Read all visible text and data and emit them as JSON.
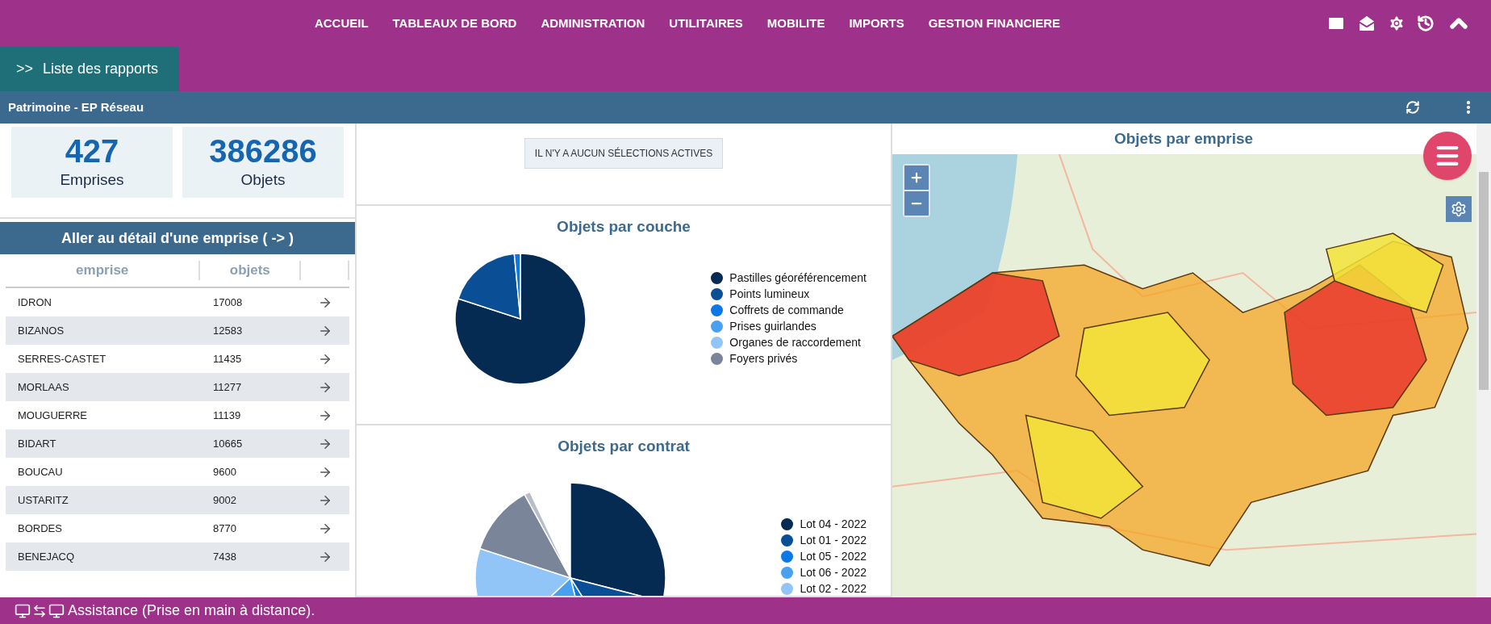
{
  "nav": {
    "items": [
      "ACCUEIL",
      "TABLEAUX DE BORD",
      "ADMINISTRATION",
      "UTILITAIRES",
      "MOBILITE",
      "IMPORTS",
      "GESTION FINANCIERE"
    ]
  },
  "reports_button": {
    "prefix": ">>",
    "label": "Liste des rapports"
  },
  "page_title": "Patrimoine - EP Réseau",
  "stats": [
    {
      "value": "427",
      "label": "Emprises"
    },
    {
      "value": "386286",
      "label": "Objets"
    }
  ],
  "detail_table": {
    "title": "Aller au détail d'une emprise ( -> )",
    "columns": [
      "emprise",
      "objets"
    ],
    "rows": [
      {
        "emprise": "IDRON",
        "objets": "17008"
      },
      {
        "emprise": "BIZANOS",
        "objets": "12583"
      },
      {
        "emprise": "SERRES-CASTET",
        "objets": "11435"
      },
      {
        "emprise": "MORLAAS",
        "objets": "11277"
      },
      {
        "emprise": "MOUGUERRE",
        "objets": "11139"
      },
      {
        "emprise": "BIDART",
        "objets": "10665"
      },
      {
        "emprise": "BOUCAU",
        "objets": "9600"
      },
      {
        "emprise": "USTARITZ",
        "objets": "9002"
      },
      {
        "emprise": "BORDES",
        "objets": "8770"
      },
      {
        "emprise": "BENEJACQ",
        "objets": "7438"
      }
    ]
  },
  "selection_notice": "IL N'Y A AUCUN SÉLECTIONS ACTIVES",
  "charts": [
    {
      "title": "Objets par couche",
      "legend": [
        {
          "label": "Pastilles géoréférencement",
          "color": "#052b52"
        },
        {
          "label": "Points lumineux",
          "color": "#0a4f96"
        },
        {
          "label": "Coffrets de commande",
          "color": "#0a78e6"
        },
        {
          "label": "Prises guirlandes",
          "color": "#4aa0f0"
        },
        {
          "label": "Organes de raccordement",
          "color": "#92c5f7"
        },
        {
          "label": "Foyers privés",
          "color": "#7a8599"
        }
      ]
    },
    {
      "title": "Objets par contrat",
      "legend": [
        {
          "label": "Lot 04 - 2022",
          "color": "#052b52"
        },
        {
          "label": "Lot 01 - 2022",
          "color": "#0a4f96"
        },
        {
          "label": "Lot 05 - 2022",
          "color": "#0a78e6"
        },
        {
          "label": "Lot 06 - 2022",
          "color": "#4aa0f0"
        },
        {
          "label": "Lot 02 - 2022",
          "color": "#92c5f7"
        }
      ]
    }
  ],
  "map": {
    "title": "Objets par emprise"
  },
  "footer": {
    "text": "Assistance (Prise en main à distance)."
  }
}
